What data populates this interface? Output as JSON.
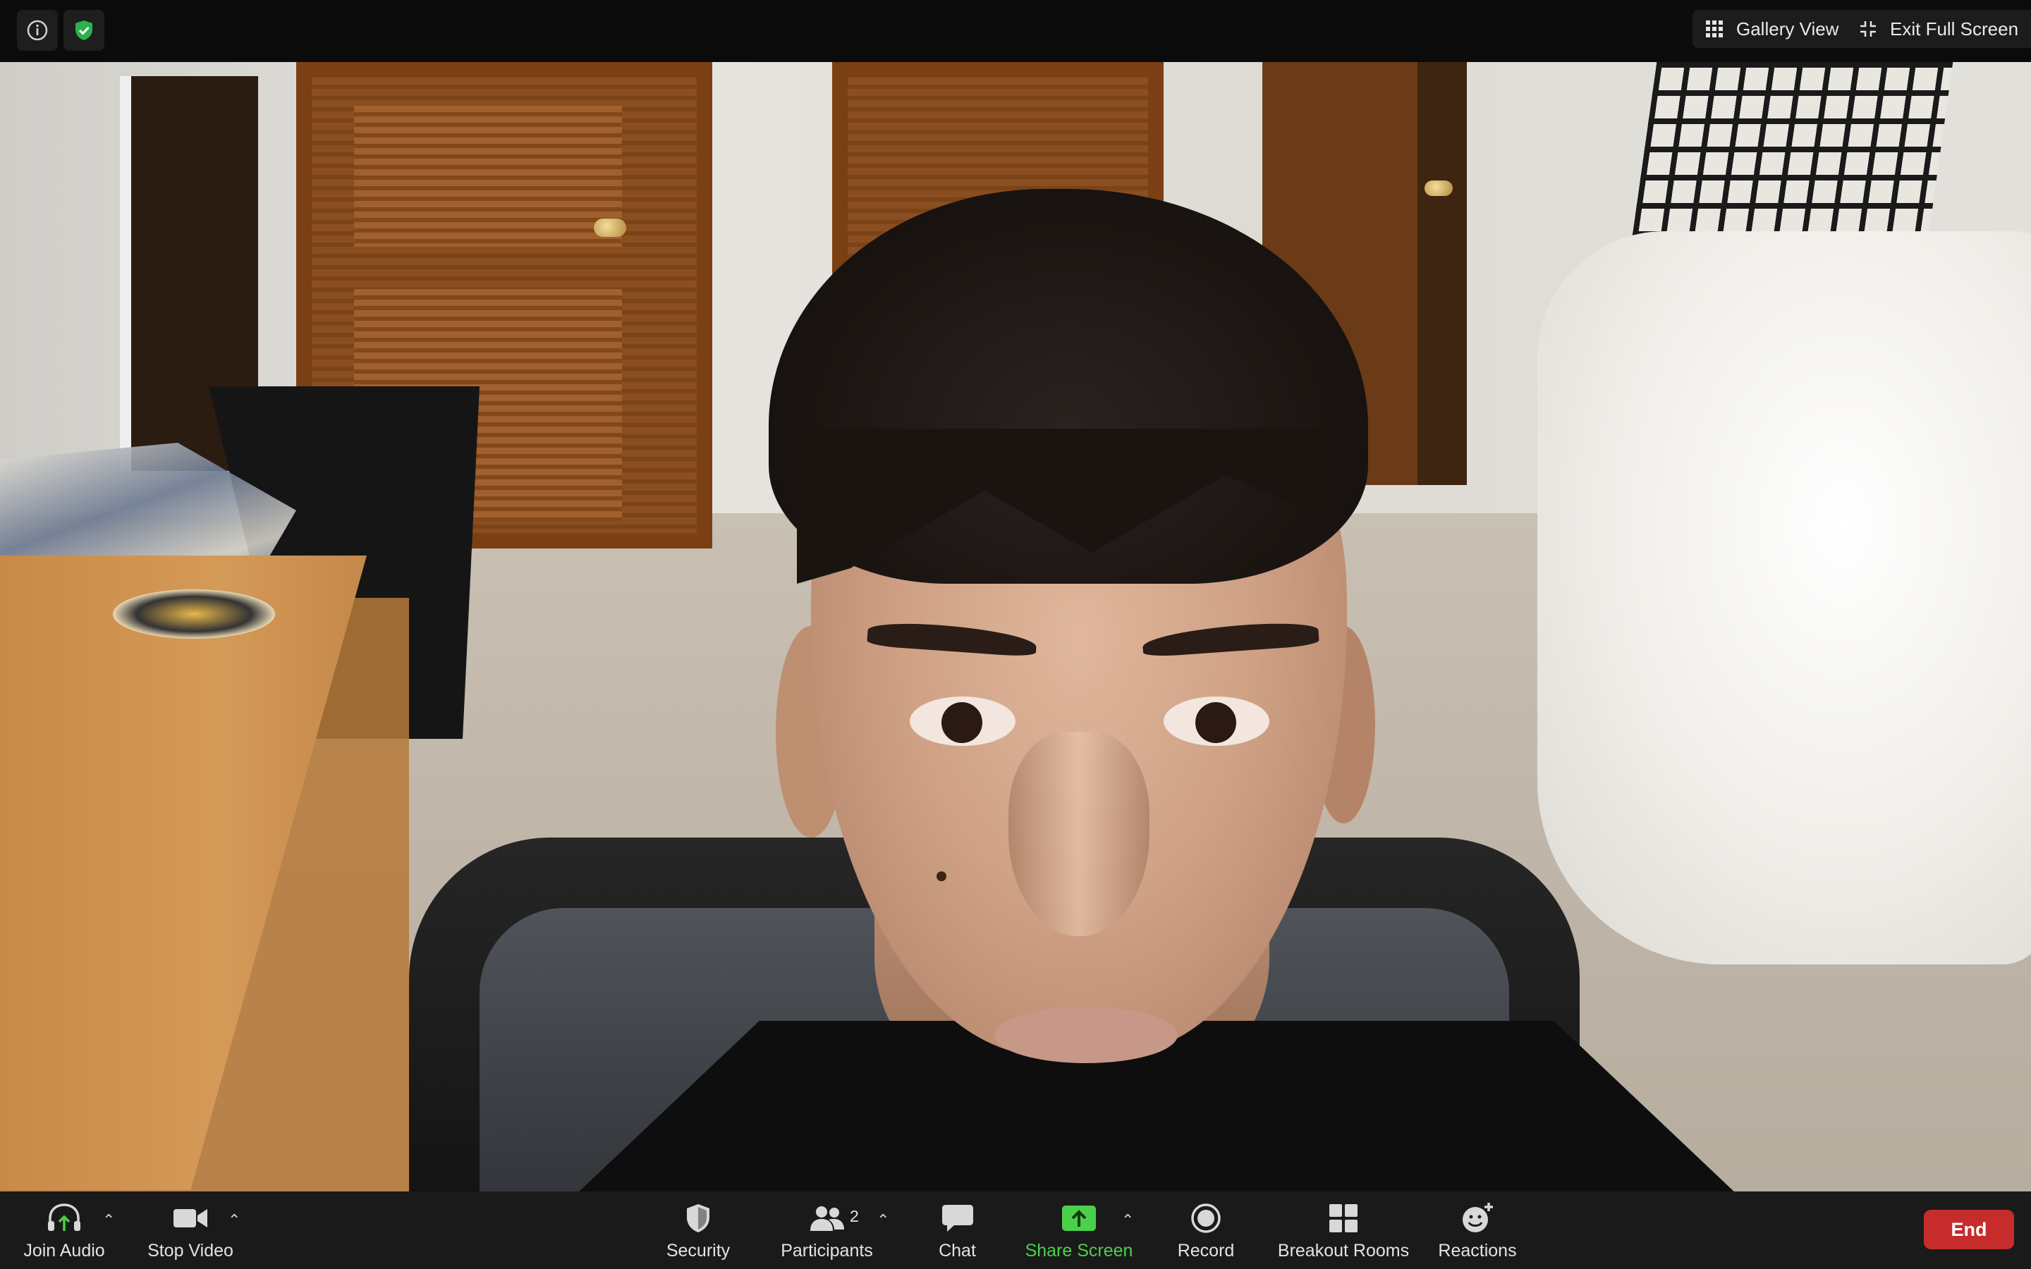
{
  "topbar": {
    "info_icon": "info-circle-icon",
    "security_status_icon": "shield-check-icon",
    "gallery_view_label": "Gallery View",
    "exit_fullscreen_label": "Exit Full Screen"
  },
  "toolbar": {
    "join_audio": "Join Audio",
    "stop_video": "Stop Video",
    "security": "Security",
    "participants": "Participants",
    "participants_count": "2",
    "chat": "Chat",
    "share_screen": "Share Screen",
    "record": "Record",
    "breakout_rooms": "Breakout Rooms",
    "reactions": "Reactions",
    "end": "End"
  },
  "colors": {
    "share_green": "#4bd04b",
    "end_red": "#c62c2c",
    "shield_green": "#2bb24c"
  }
}
